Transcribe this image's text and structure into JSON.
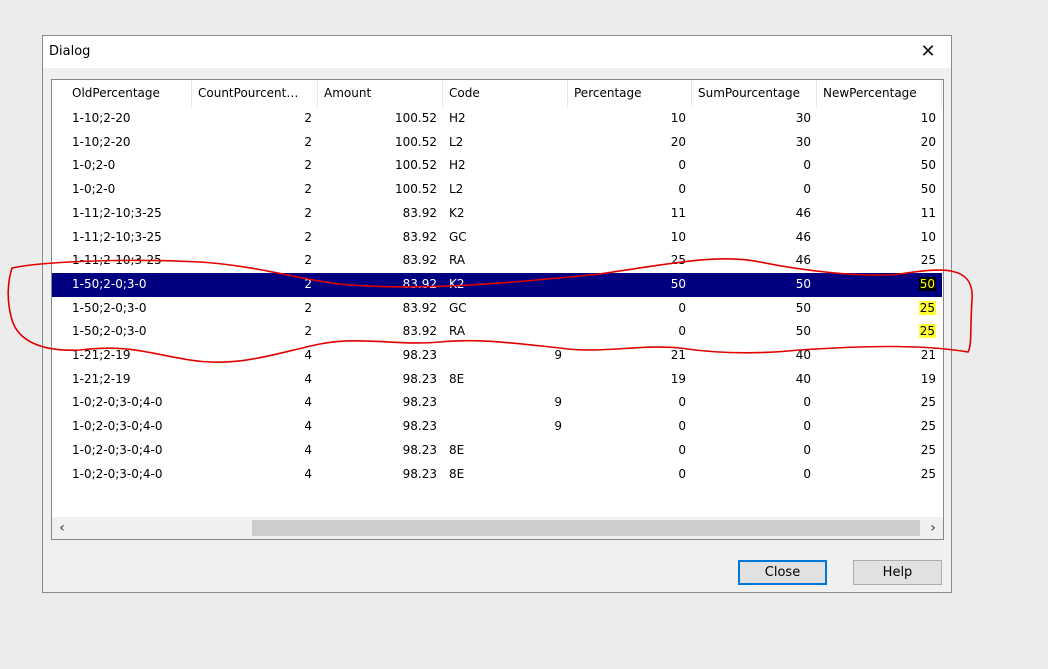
{
  "dialog": {
    "title": "Dialog",
    "close_glyph": "✕",
    "buttons": {
      "close": "Close",
      "help": "Help"
    }
  },
  "table": {
    "columns": [
      "OldPercentage",
      "CountPourcent…",
      "Amount",
      "Code",
      "Percentage",
      "SumPourcentage",
      "NewPercentage"
    ],
    "selected_row": 7,
    "highlighted_new_percentage_rows": [
      7,
      8,
      9
    ],
    "rows": [
      [
        "1-10;2-20",
        "2",
        "100.52",
        "H2",
        "",
        "10",
        "30",
        "10"
      ],
      [
        "1-10;2-20",
        "2",
        "100.52",
        "L2",
        "",
        "20",
        "30",
        "20"
      ],
      [
        "1-0;2-0",
        "2",
        "100.52",
        "H2",
        "",
        "0",
        "0",
        "50"
      ],
      [
        "1-0;2-0",
        "2",
        "100.52",
        "L2",
        "",
        "0",
        "0",
        "50"
      ],
      [
        "1-11;2-10;3-25",
        "2",
        "83.92",
        "K2",
        "",
        "11",
        "46",
        "11"
      ],
      [
        "1-11;2-10;3-25",
        "2",
        "83.92",
        "GC",
        "",
        "10",
        "46",
        "10"
      ],
      [
        "1-11;2-10;3-25",
        "2",
        "83.92",
        "RA",
        "",
        "25",
        "46",
        "25"
      ],
      [
        "1-50;2-0;3-0",
        "2",
        "83.92",
        "K2",
        "",
        "50",
        "50",
        "50"
      ],
      [
        "1-50;2-0;3-0",
        "2",
        "83.92",
        "GC",
        "",
        "0",
        "50",
        "25"
      ],
      [
        "1-50;2-0;3-0",
        "2",
        "83.92",
        "RA",
        "",
        "0",
        "50",
        "25"
      ],
      [
        "1-21;2-19",
        "4",
        "98.23",
        "",
        "9",
        "21",
        "40",
        "21"
      ],
      [
        "1-21;2-19",
        "4",
        "98.23",
        "8E",
        "",
        "19",
        "40",
        "19"
      ],
      [
        "1-0;2-0;3-0;4-0",
        "4",
        "98.23",
        "",
        "9",
        "0",
        "0",
        "25"
      ],
      [
        "1-0;2-0;3-0;4-0",
        "4",
        "98.23",
        "",
        "9",
        "0",
        "0",
        "25"
      ],
      [
        "1-0;2-0;3-0;4-0",
        "4",
        "98.23",
        "8E",
        "",
        "0",
        "0",
        "25"
      ],
      [
        "1-0;2-0;3-0;4-0",
        "4",
        "98.23",
        "8E",
        "",
        "0",
        "0",
        "25"
      ]
    ]
  },
  "scrollbar": {
    "left_glyph": "‹",
    "right_glyph": "›"
  },
  "colors": {
    "selection": "#000080",
    "highlight": "#ffff33",
    "annotation": "#e00000"
  }
}
